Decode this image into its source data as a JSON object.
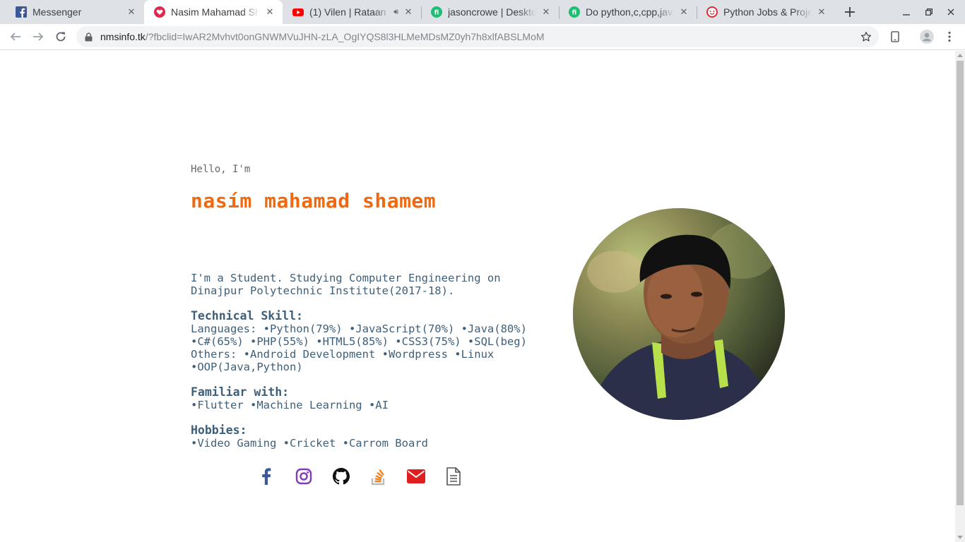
{
  "browser": {
    "tabs": [
      {
        "title": "Messenger",
        "favicon": "facebook-icon",
        "active": false
      },
      {
        "title": "Nasim Mahamad Shamem",
        "favicon": "heart-icon",
        "active": true
      },
      {
        "title": "(1) Vilen | Rataan",
        "favicon": "youtube-icon",
        "active": false,
        "audio": true
      },
      {
        "title": "jasoncrowe | Desktop",
        "favicon": "fiverr-icon",
        "active": false
      },
      {
        "title": "Do python,c,cpp,java",
        "favicon": "fiverr-icon",
        "active": false
      },
      {
        "title": "Python Jobs & Projects",
        "favicon": "freelancer-icon",
        "active": false
      }
    ],
    "url_host": "nmsinfo.tk",
    "url_rest": "/?fbclid=IwAR2Mvhvt0onGNWMVuJHN-zLA_OgIYQS8l3HLMeMDsMZ0yh7h8xlfABSLMoM",
    "accent": "#1a73e8"
  },
  "page": {
    "greeting": "Hello, I'm",
    "name": "nasím mahamad shamem",
    "name_color": "#f0690f",
    "intro": [
      "I'm a Student. Studying Computer Engineering on",
      "Dinajpur Polytechnic Institute(2017-18)."
    ],
    "technical_heading": "Technical Skill:",
    "technical_lines": [
      "Languages: •Python(79%) •JavaScript(70%) •Java(80%)",
      "•C#(65%) •PHP(55%) •HTML5(85%) •CSS3(75%) •SQL(beg)",
      "Others: •Android Development •Wordpress •Linux",
      "•OOP(Java,Python)"
    ],
    "familiar_heading": "Familiar with:",
    "familiar_line": "•Flutter •Machine Learning •AI",
    "hobbies_heading": "Hobbies:",
    "hobbies_line": "•Video Gaming •Cricket •Carrom Board",
    "social_icons": [
      "facebook-icon",
      "instagram-icon",
      "github-icon",
      "stackoverflow-icon",
      "email-icon",
      "document-icon"
    ],
    "social_colors": {
      "facebook": "#3b5998",
      "instagram": "#833ab4",
      "github": "#111111",
      "stackoverflow": "#f48024",
      "email": "#e02020",
      "document": "#555555"
    }
  }
}
